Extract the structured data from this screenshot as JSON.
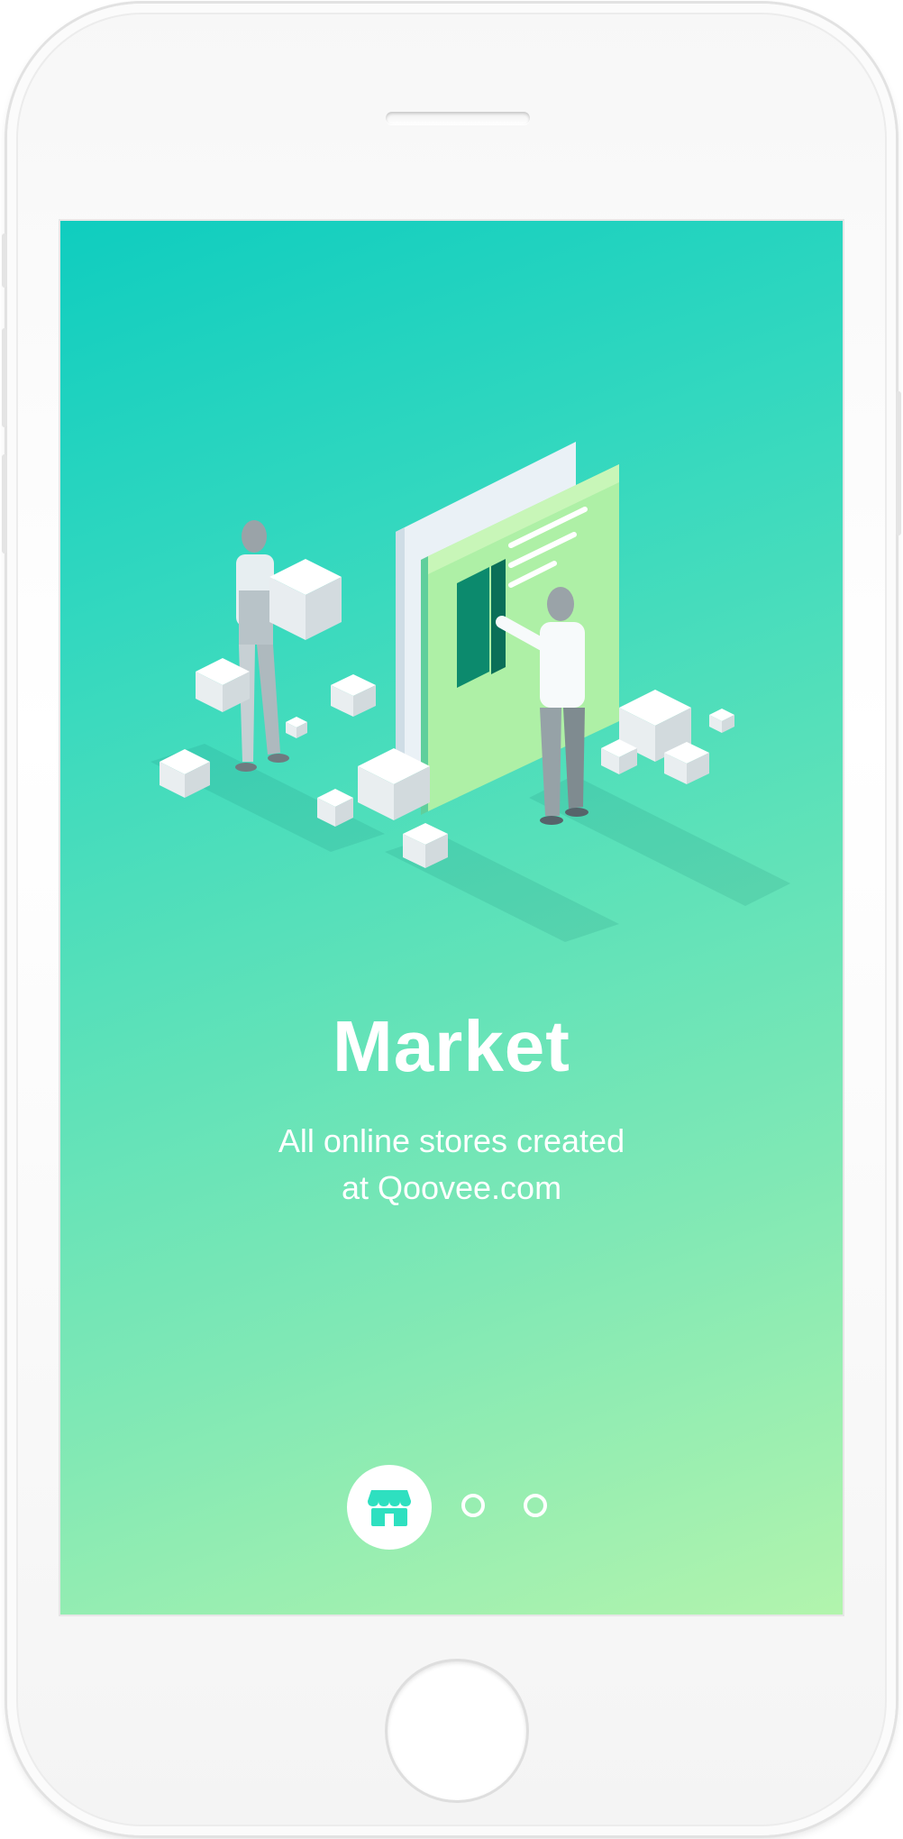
{
  "onboarding": {
    "title": "Market",
    "subtitle_line1": "All online stores created",
    "subtitle_line2": "at Qoovee.com"
  },
  "pager": {
    "total_pages": 3,
    "active_page": 1,
    "active_icon": "store-icon"
  },
  "colors": {
    "gradient_start": "#0fcdbf",
    "gradient_end": "#b2f4ad",
    "accent": "#2ee0c0",
    "text": "#ffffff"
  }
}
